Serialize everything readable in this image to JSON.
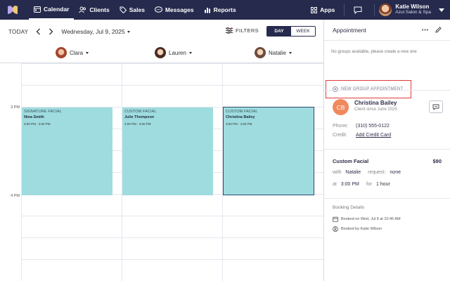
{
  "nav": {
    "items": [
      {
        "label": "Calendar",
        "icon": "calendar-icon"
      },
      {
        "label": "Clients",
        "icon": "clients-icon"
      },
      {
        "label": "Sales",
        "icon": "tag-icon"
      },
      {
        "label": "Messages",
        "icon": "messages-icon"
      },
      {
        "label": "Reports",
        "icon": "reports-icon"
      }
    ],
    "apps_label": "Apps",
    "user_name": "Katie Wilson",
    "user_business": "Azul Salon & Spa"
  },
  "toolbar": {
    "today": "TODAY",
    "date": "Wednesday, Jul 9, 2025",
    "filters": "FILTERS",
    "view_day": "DAY",
    "view_week": "WEEK"
  },
  "staff": [
    {
      "name": "Clara"
    },
    {
      "name": "Lauren"
    },
    {
      "name": "Natalie"
    }
  ],
  "times": [
    "3 PM",
    "4 PM"
  ],
  "appointments": [
    {
      "service": "SIGNATURE FACIAL",
      "client": "Nina Smith",
      "time": "3:00 PM - 4:00 PM"
    },
    {
      "service": "CUSTOM FACIAL",
      "client": "Julie Thompson",
      "time": "3:00 PM - 4:00 PM"
    },
    {
      "service": "CUSTOM FACIAL",
      "client": "Christina Bailey",
      "time": "3:00 PM - 4:00 PM"
    }
  ],
  "panel": {
    "title": "Appointment",
    "group_message": "No groups available, please create a new one",
    "new_group": "NEW GROUP APPOINTMENT",
    "client": {
      "initials": "CB",
      "name": "Christina Bailey",
      "since": "Client since June 2025",
      "phone_label": "Phone:",
      "phone": "(310) 555-0122",
      "credit_label": "Credit:",
      "credit_link": "Add Credit Card"
    },
    "service": {
      "name": "Custom Facial",
      "price": "$90",
      "with_label": "with",
      "staff": "Natalie",
      "request_label": "request:",
      "request": "none",
      "at_label": "at",
      "time": "3:00 PM",
      "for_label": "for",
      "duration": "1 hour"
    },
    "booking": {
      "title": "Booking Details",
      "booked_on": "Booked on Wed, Jul 9 at 10:45 AM",
      "booked_by": "Booked by Katie Wilson"
    }
  },
  "colors": {
    "nav_bg": "#262a4d",
    "appointment_bg": "#9fdce0",
    "client_avatar": "#f0895e",
    "highlight": "#e03a3a"
  }
}
